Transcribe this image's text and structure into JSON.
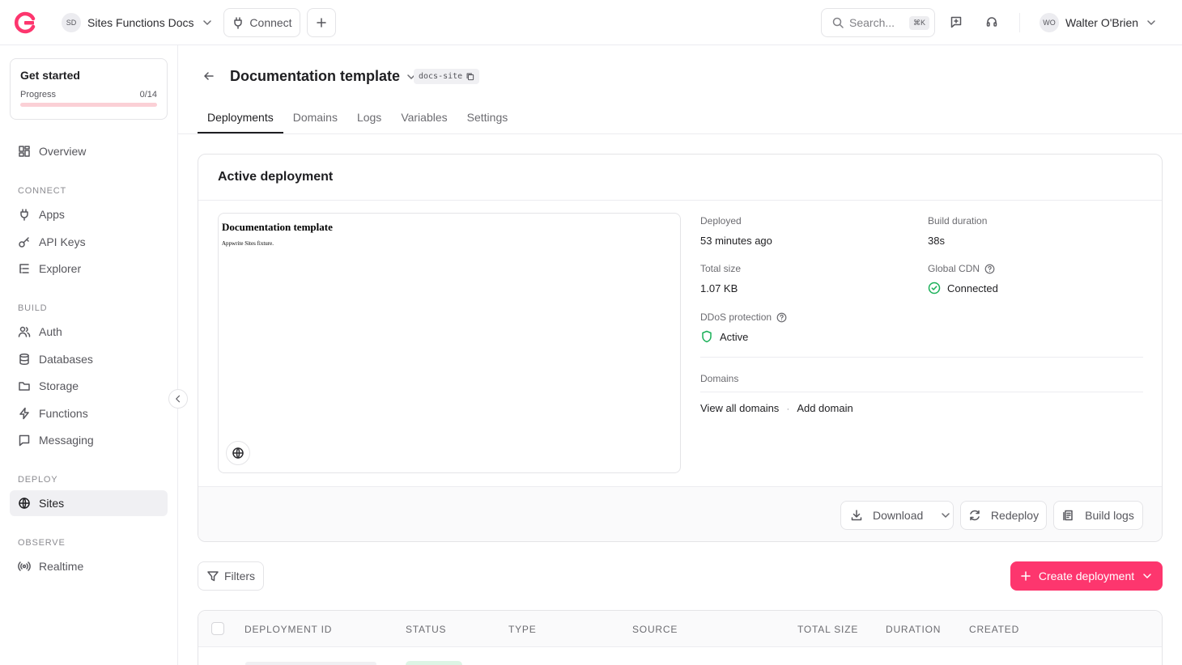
{
  "topbar": {
    "project_initials": "SD",
    "project_name": "Sites Functions Docs",
    "connect_label": "Connect",
    "search_placeholder": "Search...",
    "search_shortcut": "⌘K",
    "user_initials": "WO",
    "user_name": "Walter O'Brien"
  },
  "sidebar": {
    "get_started": {
      "title": "Get started",
      "progress_label": "Progress",
      "progress_value": "0/14",
      "progress_fraction": 0
    },
    "overview": "Overview",
    "sections": {
      "connect": "CONNECT",
      "build": "BUILD",
      "deploy": "DEPLOY",
      "observe": "OBSERVE"
    },
    "items": {
      "apps": "Apps",
      "api_keys": "API Keys",
      "explorer": "Explorer",
      "auth": "Auth",
      "databases": "Databases",
      "storage": "Storage",
      "functions": "Functions",
      "messaging": "Messaging",
      "sites": "Sites",
      "realtime": "Realtime"
    }
  },
  "header": {
    "title": "Documentation template",
    "tag": "docs-site",
    "tabs": [
      "Deployments",
      "Domains",
      "Logs",
      "Variables",
      "Settings"
    ]
  },
  "active": {
    "title": "Active deployment",
    "preview": {
      "title": "Documentation template",
      "subtitle": "Appwrite Sites fixture."
    },
    "deployed_label": "Deployed",
    "deployed_value": "53 minutes ago",
    "build_duration_label": "Build duration",
    "build_duration_value": "38s",
    "total_size_label": "Total size",
    "total_size_value": "1.07 KB",
    "cdn_label": "Global CDN",
    "cdn_value": "Connected",
    "ddos_label": "DDoS protection",
    "ddos_value": "Active",
    "domains_label": "Domains",
    "view_all_domains": "View all domains",
    "separator": "·",
    "add_domain": "Add domain",
    "download": "Download",
    "redeploy": "Redeploy",
    "build_logs": "Build logs"
  },
  "list": {
    "filters": "Filters",
    "create_deployment": "Create deployment",
    "columns": [
      "DEPLOYMENT ID",
      "STATUS",
      "TYPE",
      "SOURCE",
      "TOTAL SIZE",
      "DURATION",
      "CREATED"
    ]
  },
  "colors": {
    "accent": "#fd366e",
    "success": "#1ab058"
  }
}
